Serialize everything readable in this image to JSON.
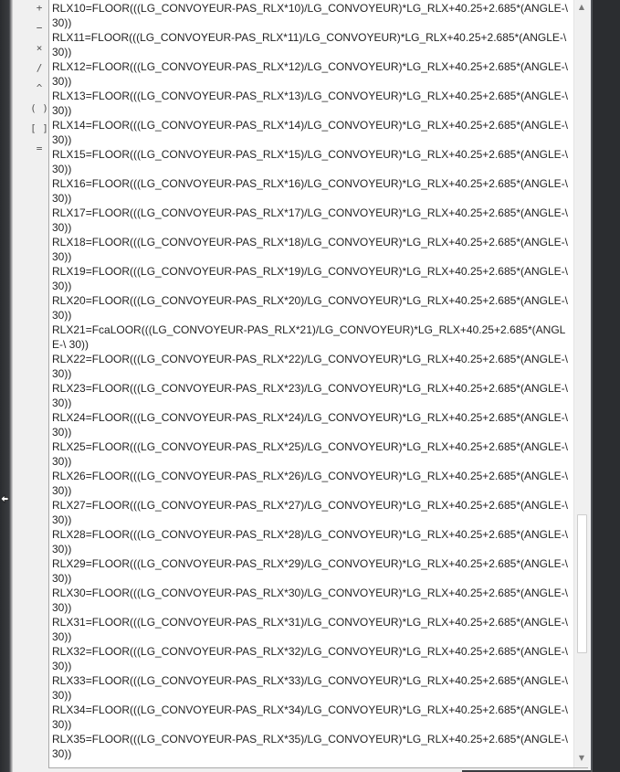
{
  "operator_buttons": [
    {
      "label": "+"
    },
    {
      "label": "−"
    },
    {
      "label": "×"
    },
    {
      "label": "/"
    },
    {
      "label": "^"
    },
    {
      "label": "( )"
    },
    {
      "label": "[ ]"
    },
    {
      "label": "="
    }
  ],
  "editor": {
    "lines": [
      "RLX10=FLOOR(((LG_CONVOYEUR-PAS_RLX*10)/LG_CONVOYEUR)*LG_RLX+40.25+2.685*(ANGLE-\\ 30))",
      "RLX11=FLOOR(((LG_CONVOYEUR-PAS_RLX*11)/LG_CONVOYEUR)*LG_RLX+40.25+2.685*(ANGLE-\\ 30))",
      "RLX12=FLOOR(((LG_CONVOYEUR-PAS_RLX*12)/LG_CONVOYEUR)*LG_RLX+40.25+2.685*(ANGLE-\\ 30))",
      "RLX13=FLOOR(((LG_CONVOYEUR-PAS_RLX*13)/LG_CONVOYEUR)*LG_RLX+40.25+2.685*(ANGLE-\\ 30))",
      "RLX14=FLOOR(((LG_CONVOYEUR-PAS_RLX*14)/LG_CONVOYEUR)*LG_RLX+40.25+2.685*(ANGLE-\\ 30))",
      "RLX15=FLOOR(((LG_CONVOYEUR-PAS_RLX*15)/LG_CONVOYEUR)*LG_RLX+40.25+2.685*(ANGLE-\\ 30))",
      "RLX16=FLOOR(((LG_CONVOYEUR-PAS_RLX*16)/LG_CONVOYEUR)*LG_RLX+40.25+2.685*(ANGLE-\\ 30))",
      "RLX17=FLOOR(((LG_CONVOYEUR-PAS_RLX*17)/LG_CONVOYEUR)*LG_RLX+40.25+2.685*(ANGLE-\\ 30))",
      "RLX18=FLOOR(((LG_CONVOYEUR-PAS_RLX*18)/LG_CONVOYEUR)*LG_RLX+40.25+2.685*(ANGLE-\\ 30))",
      "RLX19=FLOOR(((LG_CONVOYEUR-PAS_RLX*19)/LG_CONVOYEUR)*LG_RLX+40.25+2.685*(ANGLE-\\ 30))",
      "RLX20=FLOOR(((LG_CONVOYEUR-PAS_RLX*20)/LG_CONVOYEUR)*LG_RLX+40.25+2.685*(ANGLE-\\ 30))",
      "RLX21=FcaLOOR(((LG_CONVOYEUR-PAS_RLX*21)/LG_CONVOYEUR)*LG_RLX+40.25+2.685*(ANGLE-\\ 30))",
      "RLX22=FLOOR(((LG_CONVOYEUR-PAS_RLX*22)/LG_CONVOYEUR)*LG_RLX+40.25+2.685*(ANGLE-\\ 30))",
      "RLX23=FLOOR(((LG_CONVOYEUR-PAS_RLX*23)/LG_CONVOYEUR)*LG_RLX+40.25+2.685*(ANGLE-\\ 30))",
      "RLX24=FLOOR(((LG_CONVOYEUR-PAS_RLX*24)/LG_CONVOYEUR)*LG_RLX+40.25+2.685*(ANGLE-\\ 30))",
      "RLX25=FLOOR(((LG_CONVOYEUR-PAS_RLX*25)/LG_CONVOYEUR)*LG_RLX+40.25+2.685*(ANGLE-\\ 30))",
      "RLX26=FLOOR(((LG_CONVOYEUR-PAS_RLX*26)/LG_CONVOYEUR)*LG_RLX+40.25+2.685*(ANGLE-\\ 30))",
      "RLX27=FLOOR(((LG_CONVOYEUR-PAS_RLX*27)/LG_CONVOYEUR)*LG_RLX+40.25+2.685*(ANGLE-\\ 30))",
      "RLX28=FLOOR(((LG_CONVOYEUR-PAS_RLX*28)/LG_CONVOYEUR)*LG_RLX+40.25+2.685*(ANGLE-\\ 30))",
      "RLX29=FLOOR(((LG_CONVOYEUR-PAS_RLX*29)/LG_CONVOYEUR)*LG_RLX+40.25+2.685*(ANGLE-\\ 30))",
      "RLX30=FLOOR(((LG_CONVOYEUR-PAS_RLX*30)/LG_CONVOYEUR)*LG_RLX+40.25+2.685*(ANGLE-\\ 30))",
      "RLX31=FLOOR(((LG_CONVOYEUR-PAS_RLX*31)/LG_CONVOYEUR)*LG_RLX+40.25+2.685*(ANGLE-\\ 30))",
      "RLX32=FLOOR(((LG_CONVOYEUR-PAS_RLX*32)/LG_CONVOYEUR)*LG_RLX+40.25+2.685*(ANGLE-\\ 30))",
      "RLX33=FLOOR(((LG_CONVOYEUR-PAS_RLX*33)/LG_CONVOYEUR)*LG_RLX+40.25+2.685*(ANGLE-\\ 30))",
      "RLX34=FLOOR(((LG_CONVOYEUR-PAS_RLX*34)/LG_CONVOYEUR)*LG_RLX+40.25+2.685*(ANGLE-\\ 30))",
      "RLX35=FLOOR(((LG_CONVOYEUR-PAS_RLX*35)/LG_CONVOYEUR)*LG_RLX+40.25+2.685*(ANGLE-\\ 30))"
    ]
  },
  "scrollbar": {
    "up_icon": "triangle-up",
    "down_icon": "triangle-down",
    "up_glyph": "▲",
    "down_glyph": "▼"
  },
  "colors": {
    "text": "#222222",
    "editor_border": "#a9a9a9",
    "panel_bg": "#f0f0f0",
    "dark_chrome": "#2b2d30"
  }
}
